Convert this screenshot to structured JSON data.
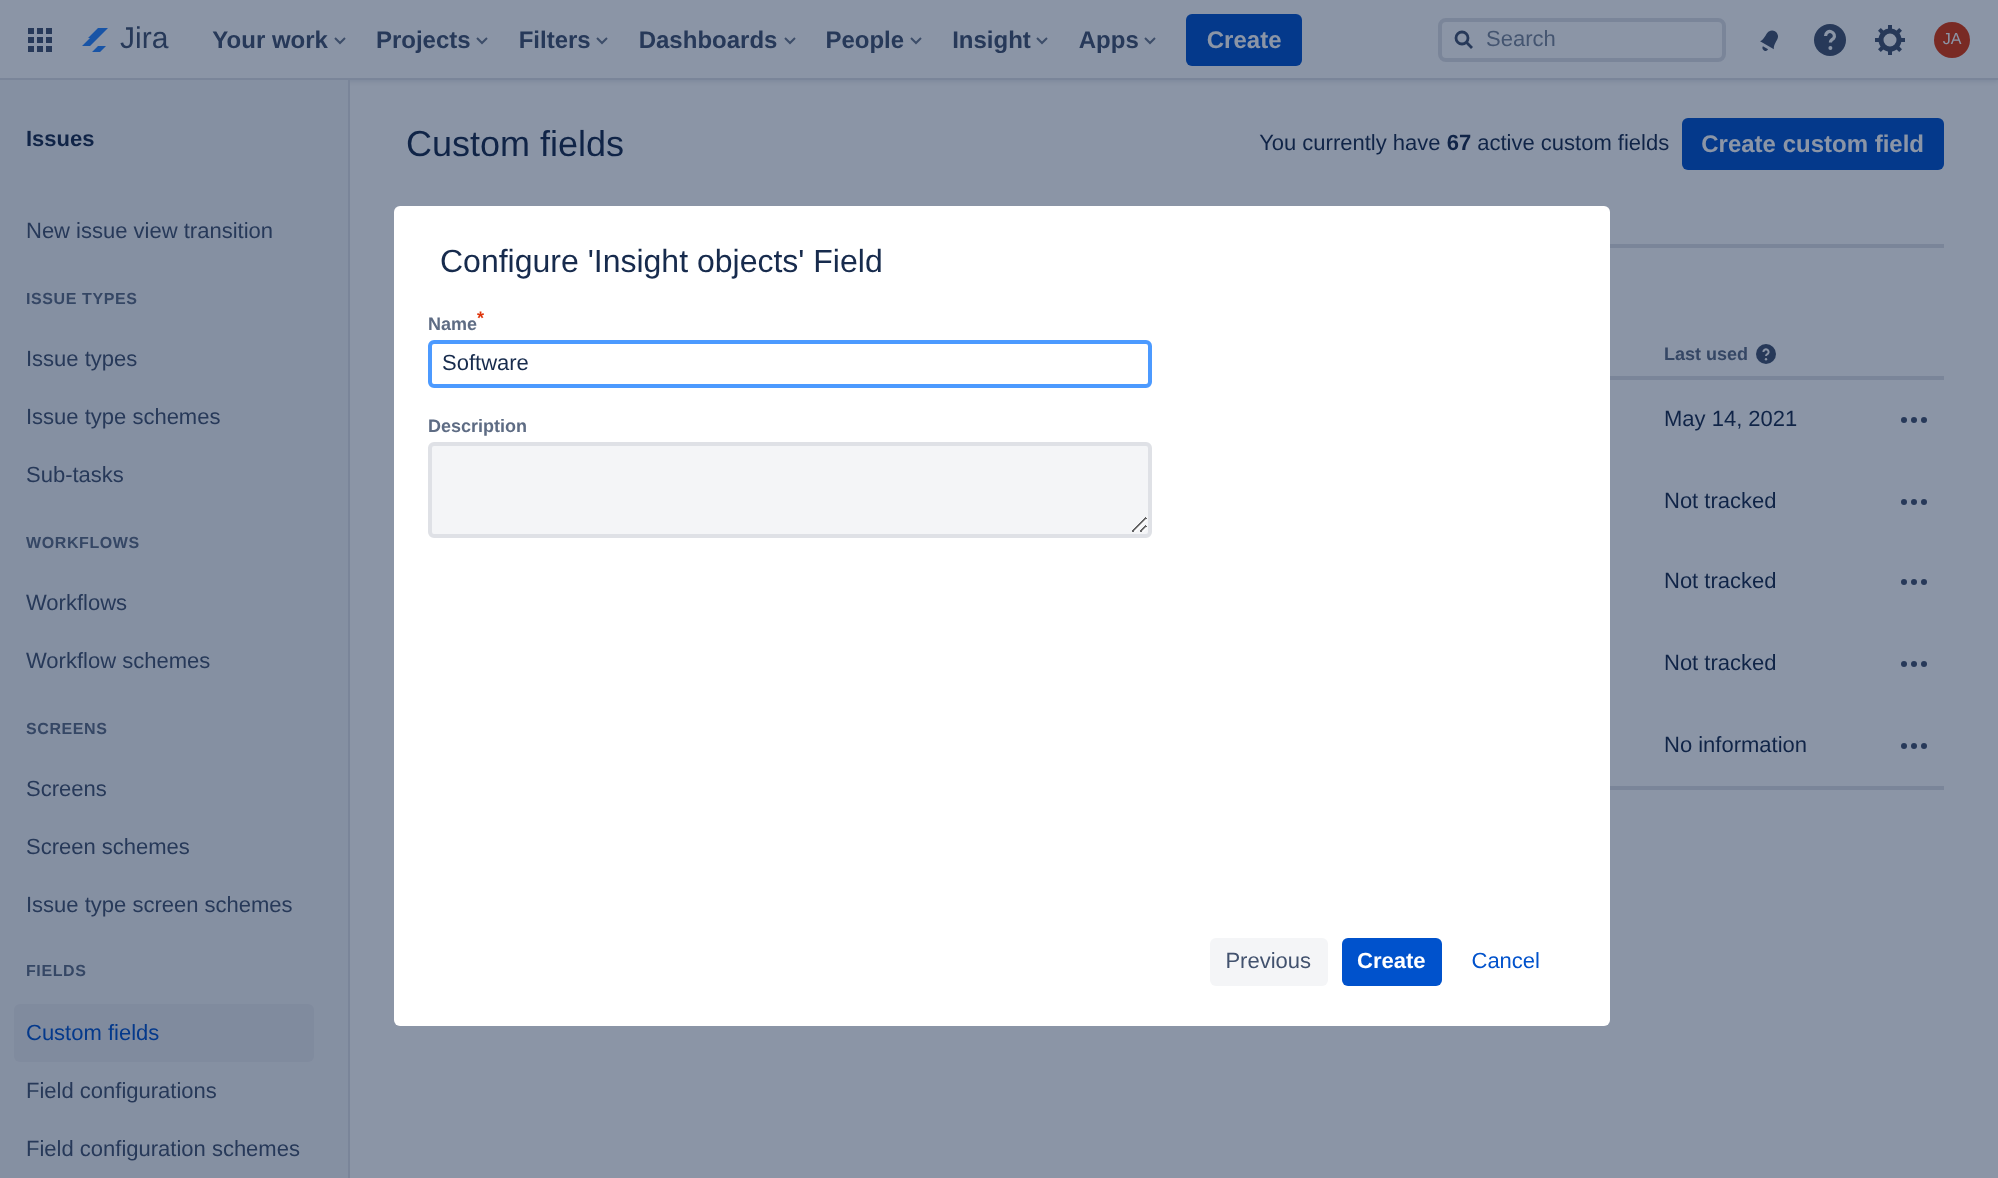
{
  "topnav": {
    "product": "Jira",
    "menus": [
      "Your work",
      "Projects",
      "Filters",
      "Dashboards",
      "People",
      "Insight",
      "Apps"
    ],
    "create": "Create",
    "search": {
      "placeholder": "Search"
    },
    "avatar": "JA"
  },
  "sidebar": {
    "title": "Issues",
    "sections": [
      {
        "items": [
          {
            "label": "New issue view transition",
            "selected": false
          }
        ]
      },
      {
        "heading": "ISSUE TYPES",
        "items": [
          {
            "label": "Issue types",
            "selected": false
          },
          {
            "label": "Issue type schemes",
            "selected": false
          },
          {
            "label": "Sub-tasks",
            "selected": false
          }
        ]
      },
      {
        "heading": "WORKFLOWS",
        "items": [
          {
            "label": "Workflows",
            "selected": false
          },
          {
            "label": "Workflow schemes",
            "selected": false
          }
        ]
      },
      {
        "heading": "SCREENS",
        "items": [
          {
            "label": "Screens",
            "selected": false
          },
          {
            "label": "Screen schemes",
            "selected": false
          },
          {
            "label": "Issue type screen schemes",
            "selected": false
          }
        ]
      },
      {
        "heading": "FIELDS",
        "items": [
          {
            "label": "Custom fields",
            "selected": true
          },
          {
            "label": "Field configurations",
            "selected": false
          },
          {
            "label": "Field configuration schemes",
            "selected": false
          }
        ]
      }
    ]
  },
  "page": {
    "title": "Custom fields",
    "summary": "You currently have **67** active custom fields",
    "create_button": "Create custom field"
  },
  "table": {
    "column_header": "Last used",
    "rows": [
      {
        "last_used": "May 14, 2021"
      },
      {
        "last_used": "Not tracked"
      },
      {
        "last_used": "Not tracked"
      },
      {
        "last_used": "Not tracked"
      },
      {
        "last_used": "No information"
      }
    ]
  },
  "dialog": {
    "title": "Configure 'Insight objects' Field",
    "name_label": "Name",
    "required_mark": "*",
    "name_value": "Software",
    "description_label": "Description",
    "buttons": {
      "previous": "Previous",
      "create": "Create",
      "cancel": "Cancel"
    }
  }
}
